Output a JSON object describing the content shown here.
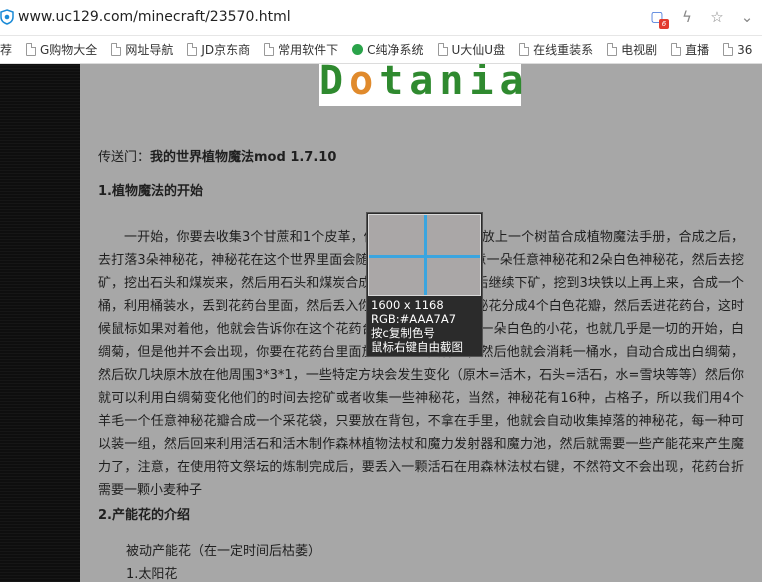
{
  "browser": {
    "url": "www.uc129.com/minecraft/23570.html",
    "shield_badge": "6"
  },
  "bookmarks": [
    {
      "label": "G购物大全"
    },
    {
      "label": "网址导航"
    },
    {
      "label": "JD京东商"
    },
    {
      "label": "常用软件下"
    },
    {
      "label": "C纯净系统"
    },
    {
      "label": "U大仙U盘"
    },
    {
      "label": "在线重装系"
    },
    {
      "label": "电视剧"
    },
    {
      "label": "直播"
    },
    {
      "label": "36"
    }
  ],
  "bookmarks_first": "荐",
  "logo": {
    "text_a": "D",
    "text_leaf": "o",
    "text_b": "tania"
  },
  "article": {
    "portal_prefix": "传送门：",
    "portal_link": "我的世界植物魔法mod 1.7.10",
    "section1_title": "1.植物魔法的开始",
    "section1_body": "一开始，你要去收集3个甘蔗和1个皮革，做成一本书，然后在放上一个树苗合成植物魔法手册，合成之后，去打落3朵神秘花，神秘花在这个世界里面会随机生长，然后用任意一朵任意神秘花和2朵白色神秘花，然后去挖矿，挖出石头和煤炭来，然后用石头和煤炭合成植物魔法药台，然后继续下矿，挖到3块铁以上再上来，合成一个桶，利用桶装水，丢到花药台里面，然后丢入你之前打到的白色神秘花分成4个白色花瓣，然后丢进花药台，这时候鼠标如果对着他，他就会告诉你在这个花药台可以出现的物品，一朵白色的小花，也就几乎是一切的开始，白绸菊，但是他并不会出现，你要在花药台里面放入一个小麦种子，然后他就会消耗一桶水，自动合成出白绸菊，然后砍几块原木放在他周围3*3*1，一些特定方块会发生变化（原木=活木，石头=活石，水=雪块等等）然后你就可以利用白绸菊变化他们的时间去挖矿或者收集一些神秘花，当然，神秘花有16种，占格子，所以我们用4个羊毛一个任意神秘花瓣合成一个采花袋，只要放在背包，不拿在手里，他就会自动收集掉落的神秘花，每一种可以装一组，然后回来利用活石和活木制作森林植物法杖和魔力发射器和魔力池，然后就需要一些产能花来产生魔力了，注意，在使用符文祭坛的炼制完成后，要丢入一颗活石在用森林法杖右键，不然符文不会出现，花药台折需要一颗小麦种子",
    "section2_title": "2.产能花的介绍",
    "section2_line1": "被动产能花（在一定时间后枯萎）",
    "section2_line2": "1.太阳花"
  },
  "color_picker": {
    "size": "1600 x 1168",
    "rgb": "RGB:#AAA7A7",
    "hint_copy": "按c复制色号",
    "hint_capture": "鼠标右键自由截图"
  },
  "colors": {
    "page_bg": "#a7a7a7",
    "picker_cross": "#3aa5e0",
    "logo_green": "#2f8a2f"
  }
}
